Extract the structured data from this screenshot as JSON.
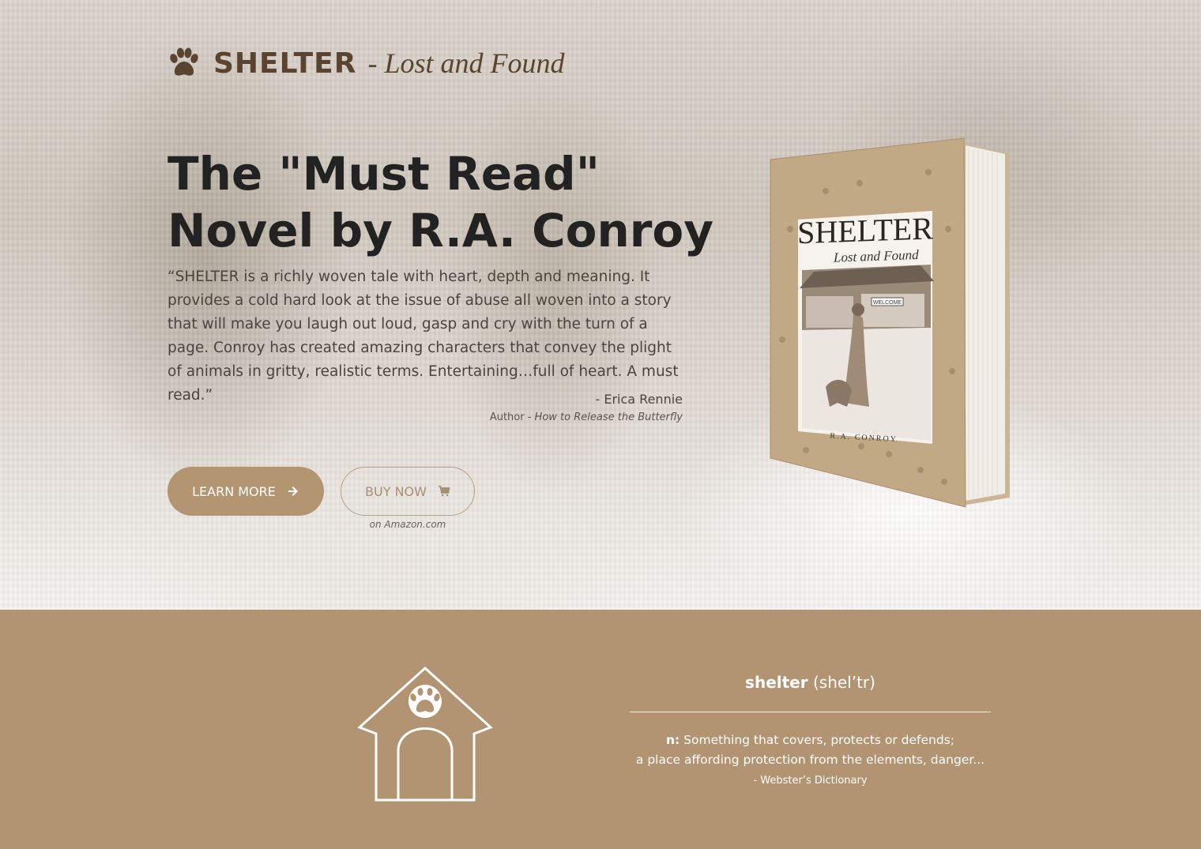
{
  "brand": {
    "title": "SHELTER",
    "subtitle": "- Lost and Found",
    "logo_icon": "paw-icon"
  },
  "hero": {
    "headline_line1": "The \"Must Read\"",
    "headline_line2": "Novel by R.A. Conroy",
    "quote": "“SHELTER is a richly woven tale with heart, depth and meaning. It provides a cold hard look at the issue of abuse all woven into a story that will make you laugh out loud, gasp and cry with the turn of a page. Conroy has created amazing characters that convey the plight of animals in gritty, realistic terms. Entertaining…full of heart. A must read.”",
    "quote_author": "- Erica Rennie",
    "quote_source_prefix": "Author - ",
    "quote_source_title": "How to Release the Butterfly",
    "learn_more_label": "LEARN MORE",
    "learn_more_icon": "arrow-right-icon",
    "buy_now_label": "BUY NOW",
    "buy_now_icon": "cart-icon",
    "buy_note": "on Amazon.com"
  },
  "book": {
    "cover_title": "SHELTER",
    "cover_subtitle": "Lost and Found",
    "cover_author": "R.A. CONROY",
    "cover_sign": "WELCOME"
  },
  "definition": {
    "word": "shelter",
    "pronunciation": "(shel’tr)",
    "pos": "n:",
    "line1": "Something that covers, protects or defends;",
    "line2": "a place affording protection from the elements, danger...",
    "citation": "- Webster’s Dictionary",
    "icon": "doghouse-icon"
  },
  "colors": {
    "brand_brown": "#5a4430",
    "accent_tan": "#b39472",
    "headline": "#222222"
  }
}
